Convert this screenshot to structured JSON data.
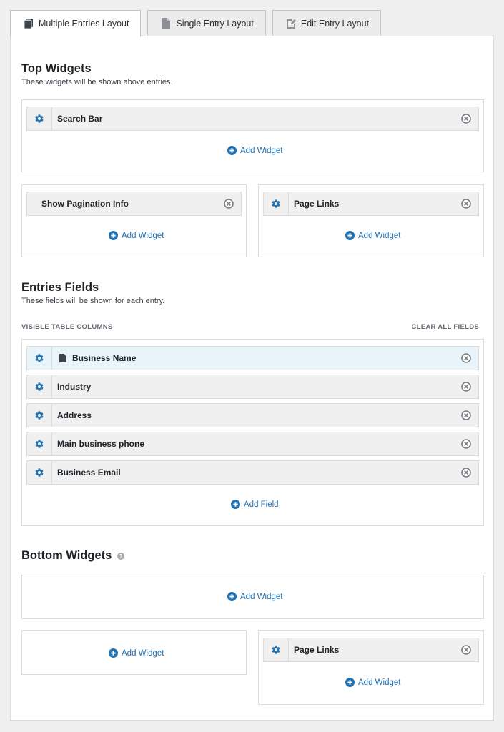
{
  "tabs": [
    {
      "label": "Multiple Entries Layout",
      "icon": "documents-icon",
      "active": true
    },
    {
      "label": "Single Entry Layout",
      "icon": "document-icon",
      "active": false
    },
    {
      "label": "Edit Entry Layout",
      "icon": "edit-document-icon",
      "active": false
    }
  ],
  "top_widgets": {
    "title": "Top Widgets",
    "description": "These widgets will be shown above entries.",
    "full_row": {
      "items": [
        "Search Bar"
      ],
      "add_label": "Add Widget"
    },
    "left": {
      "items": [
        "Show Pagination Info"
      ],
      "add_label": "Add Widget"
    },
    "right": {
      "items": [
        "Page Links"
      ],
      "add_label": "Add Widget"
    }
  },
  "entries_fields": {
    "title": "Entries Fields",
    "description": "These fields will be shown for each entry.",
    "columns_label": "VISIBLE TABLE COLUMNS",
    "clear_label": "CLEAR ALL FIELDS",
    "fields": [
      "Business Name",
      "Industry",
      "Address",
      "Main business phone",
      "Business Email"
    ],
    "add_label": "Add Field"
  },
  "bottom_widgets": {
    "title": "Bottom Widgets",
    "full_row": {
      "add_label": "Add Widget"
    },
    "left": {
      "add_label": "Add Widget"
    },
    "right": {
      "items": [
        "Page Links"
      ],
      "add_label": "Add Widget"
    }
  },
  "colors": {
    "accent": "#2271b1",
    "item_bg": "#f0f0f1",
    "highlight_bg": "#e8f4f9"
  }
}
